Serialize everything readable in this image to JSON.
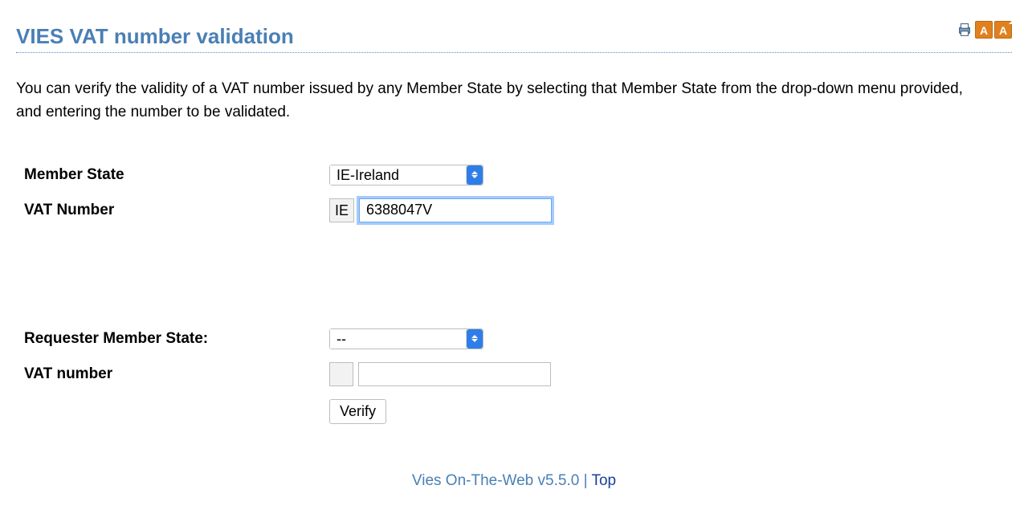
{
  "header": {
    "title": "VIES VAT number validation",
    "icons": {
      "print": "print-icon",
      "text_small": "A",
      "text_large": "A"
    }
  },
  "intro": "You can verify the validity of a VAT number issued by any Member State by selecting that Member State from the drop-down menu provided, and entering the number to be validated.",
  "form": {
    "member_state": {
      "label": "Member State",
      "selected": "IE-Ireland"
    },
    "vat_number": {
      "label": "VAT Number",
      "prefix": "IE",
      "value": "6388047V"
    },
    "requester_state": {
      "label": "Requester Member State:",
      "selected": "--"
    },
    "requester_vat": {
      "label": "VAT number",
      "prefix": "",
      "value": ""
    },
    "verify_label": "Verify"
  },
  "footer": {
    "version": "Vies On-The-Web v5.5.0",
    "separator": " | ",
    "top": "Top"
  }
}
